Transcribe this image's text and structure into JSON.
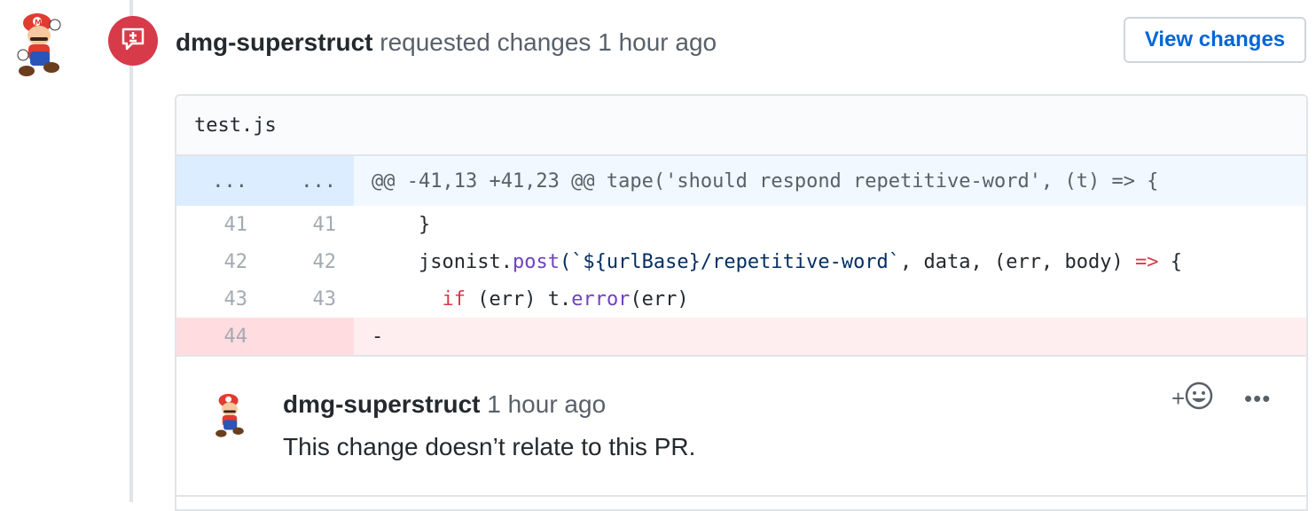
{
  "review": {
    "author": "dmg-superstruct",
    "action": "requested changes",
    "time": "1 hour ago",
    "view_changes_label": "View changes",
    "status_color": "#d73a49",
    "badge_icon": "comment-changes-icon"
  },
  "file": {
    "name": "test.js",
    "hunk": {
      "old_marker": "...",
      "new_marker": "...",
      "header": "@@ -41,13 +41,23 @@ tape('should respond repetitive-word', (t) => {"
    },
    "lines": [
      {
        "old": "41",
        "new": "41",
        "type": "context",
        "parts": [
          {
            "t": "    }",
            "c": ""
          }
        ]
      },
      {
        "old": "42",
        "new": "42",
        "type": "context",
        "parts": [
          {
            "t": "    jsonist.",
            "c": ""
          },
          {
            "t": "post",
            "c": "fn"
          },
          {
            "t": "(`${urlBase}/repetitive-word`",
            "c": "str"
          },
          {
            "t": ", data, (err, body) ",
            "c": ""
          },
          {
            "t": "=>",
            "c": "kw"
          },
          {
            "t": " {",
            "c": ""
          }
        ]
      },
      {
        "old": "43",
        "new": "43",
        "type": "context",
        "parts": [
          {
            "t": "      ",
            "c": ""
          },
          {
            "t": "if",
            "c": "kw"
          },
          {
            "t": " (err) t.",
            "c": ""
          },
          {
            "t": "error",
            "c": "fn"
          },
          {
            "t": "(err)",
            "c": ""
          }
        ]
      },
      {
        "old": "44",
        "new": "",
        "type": "deletion",
        "parts": [
          {
            "t": "-",
            "c": ""
          }
        ]
      }
    ]
  },
  "comment": {
    "author": "dmg-superstruct",
    "time": "1 hour ago",
    "body": "This change doesn’t relate to this PR.",
    "reaction_label": "+",
    "reaction_icon": "smiley-icon",
    "more_label": "•••"
  }
}
